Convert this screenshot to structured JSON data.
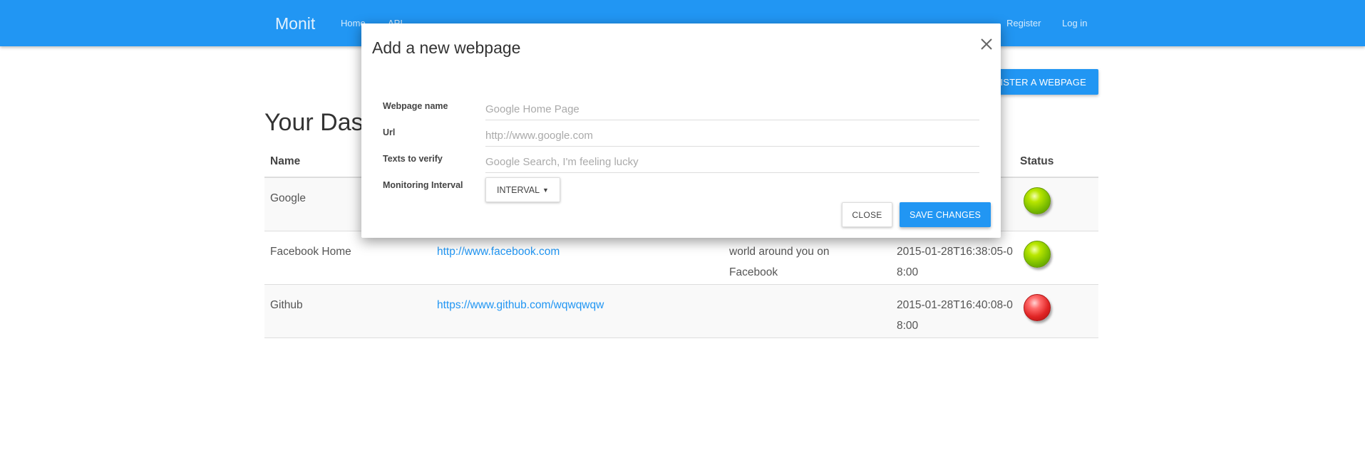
{
  "navbar": {
    "brand": "Monit",
    "links": [
      "Home",
      "API"
    ],
    "register": "Register",
    "login": "Log in"
  },
  "page": {
    "register_button": "REGISTER A WEBPAGE",
    "dashboard_title": "Your Dashboard",
    "table": {
      "headers": {
        "name": "Name",
        "status": "Status"
      },
      "rows": [
        {
          "name": "Google",
          "url": "",
          "texts": "",
          "time": "-",
          "status": "green"
        },
        {
          "name": "Facebook Home",
          "url": "http://www.facebook.com",
          "texts": "world around you on Facebook",
          "time": "2015-01-28T16:38:05-08:00",
          "status": "green"
        },
        {
          "name": "Github",
          "url": "https://www.github.com/wqwqwqw",
          "texts": "",
          "time": "2015-01-28T16:40:08-08:00",
          "status": "red"
        }
      ]
    }
  },
  "modal": {
    "title": "Add a new webpage",
    "fields": {
      "name_label": "Webpage name",
      "name_placeholder": "Google Home Page",
      "url_label": "Url",
      "url_placeholder": "http://www.google.com",
      "texts_label": "Texts to verify",
      "texts_placeholder": "Google Search, I'm feeling lucky",
      "interval_label": "Monitoring Interval"
    },
    "interval_button": "INTERVAL",
    "close_button": "CLOSE",
    "save_button": "SAVE CHANGES"
  },
  "icons": {
    "close": "close-icon",
    "caret": "caret-down-icon"
  },
  "colors": {
    "primary": "#2196f3",
    "status_green": "#8fce00",
    "status_red": "#e02424"
  }
}
